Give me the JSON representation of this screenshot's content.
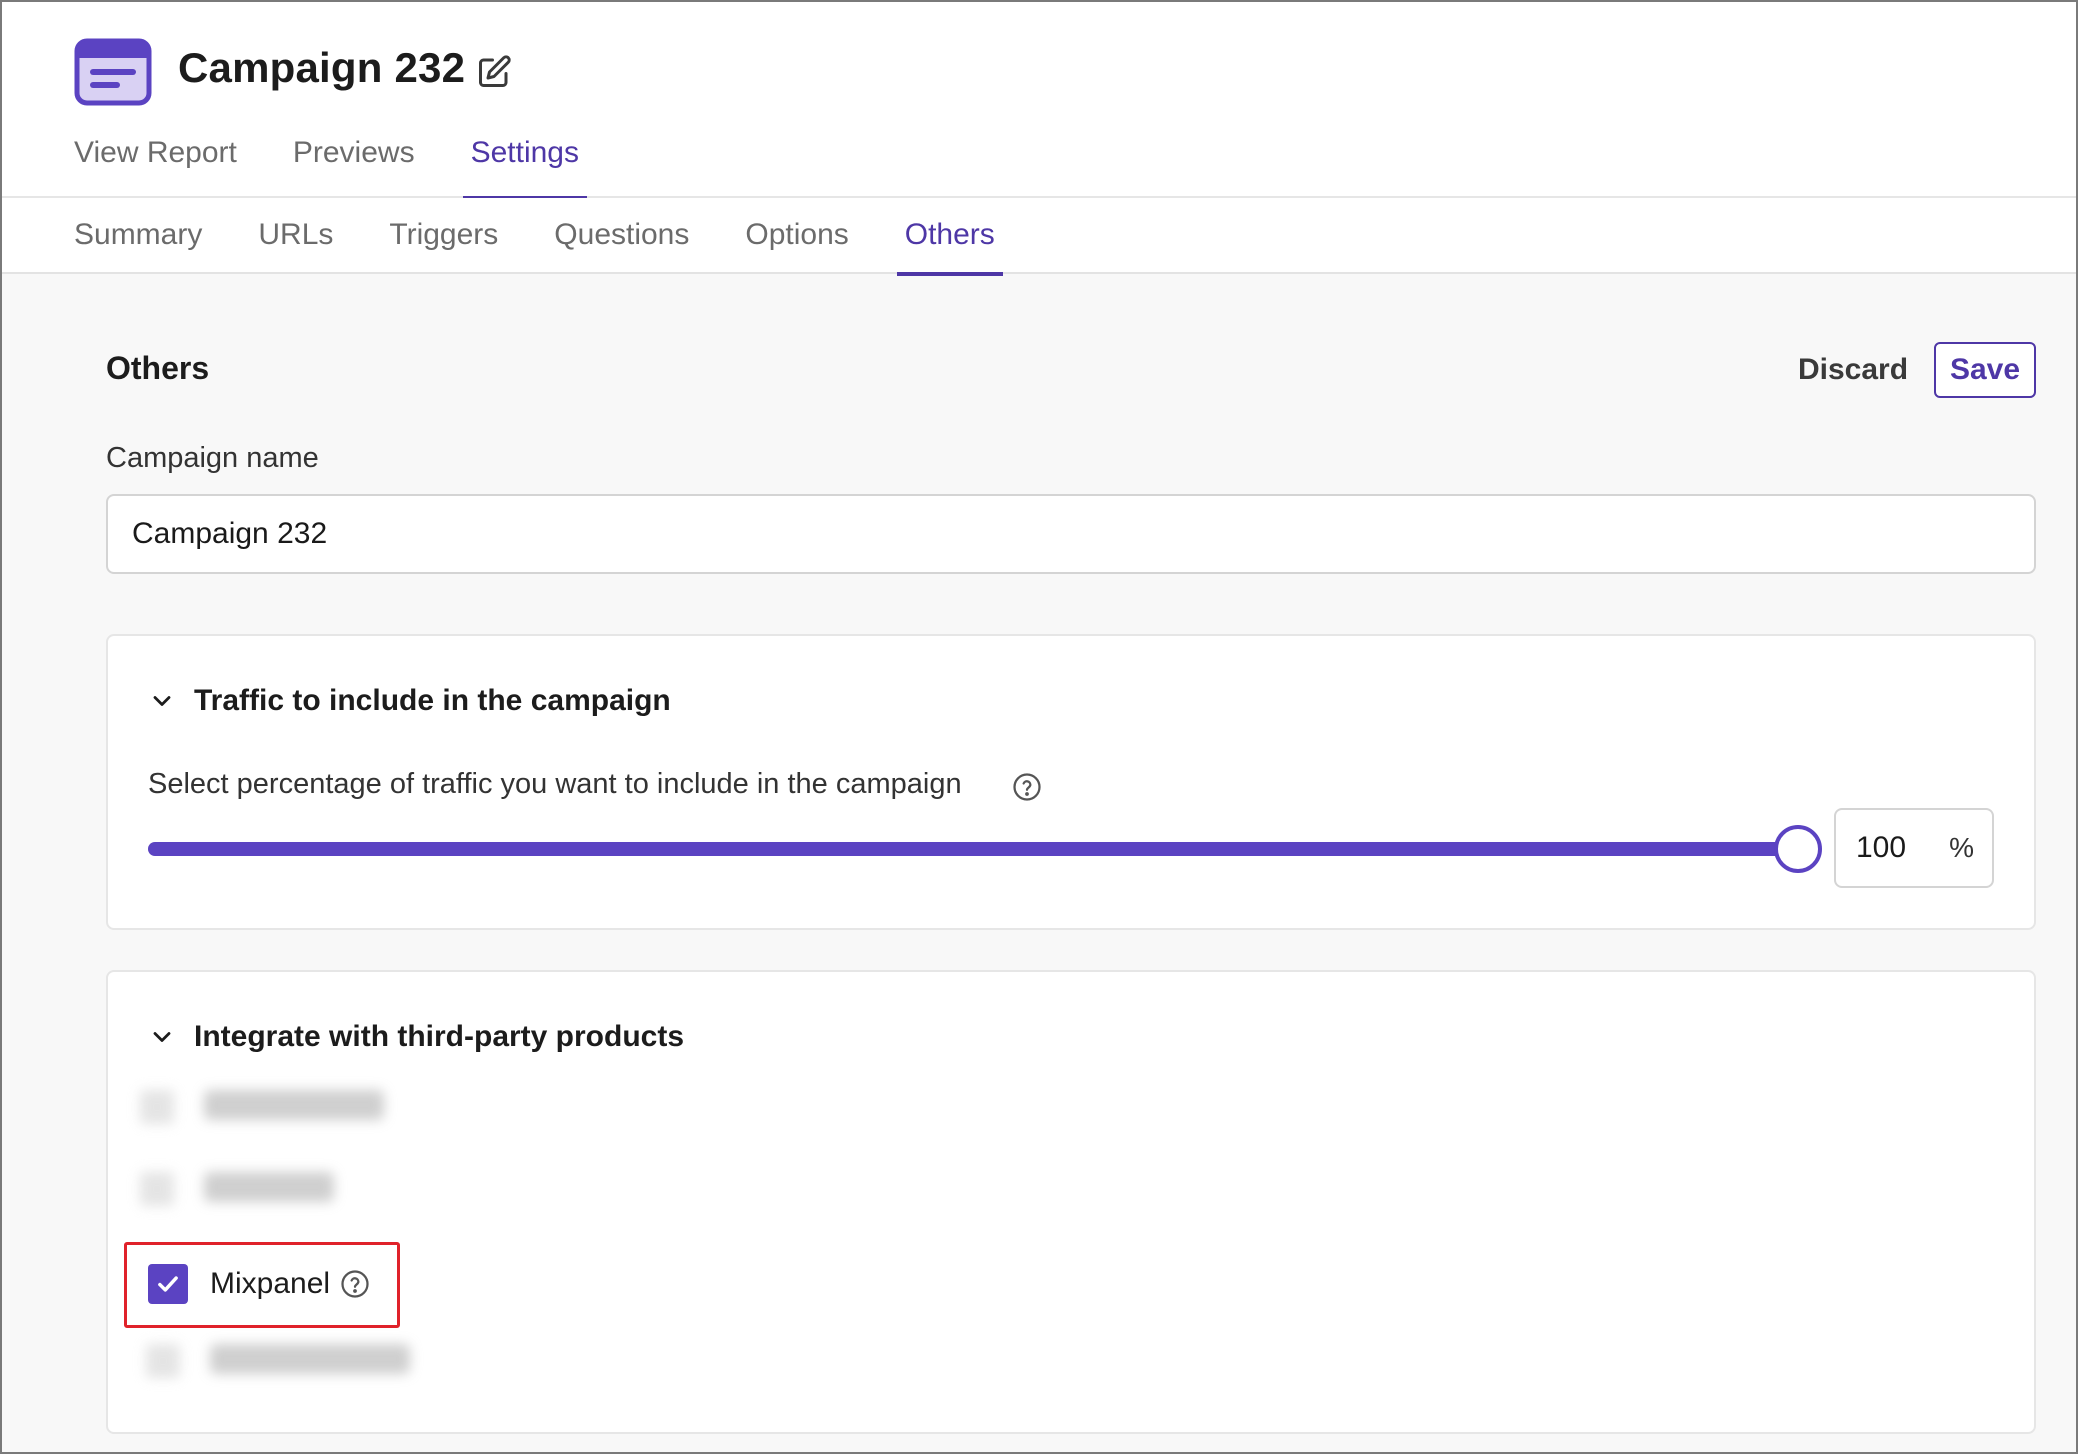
{
  "header": {
    "title": "Campaign 232",
    "tabs": [
      {
        "label": "View Report",
        "active": false
      },
      {
        "label": "Previews",
        "active": false
      },
      {
        "label": "Settings",
        "active": true
      }
    ]
  },
  "subtabs": [
    {
      "label": "Summary",
      "active": false
    },
    {
      "label": "URLs",
      "active": false
    },
    {
      "label": "Triggers",
      "active": false
    },
    {
      "label": "Questions",
      "active": false
    },
    {
      "label": "Options",
      "active": false
    },
    {
      "label": "Others",
      "active": true
    }
  ],
  "section": {
    "title": "Others",
    "discard_label": "Discard",
    "save_label": "Save"
  },
  "campaign_name": {
    "label": "Campaign name",
    "value": "Campaign 232"
  },
  "traffic": {
    "title": "Traffic to include in the campaign",
    "description": "Select percentage of traffic you want to include in the campaign",
    "percent": 100,
    "percent_value": "100",
    "unit": "%"
  },
  "integrations": {
    "title": "Integrate with third-party products",
    "items": [
      {
        "label": "Mixpanel",
        "checked": true
      }
    ]
  },
  "colors": {
    "accent": "#4e37a6",
    "slider": "#5b43c2",
    "highlight": "#e0222a"
  },
  "icons": {
    "app": "campaign-card-icon",
    "edit": "edit-pencil-icon",
    "chevron": "chevron-down-icon",
    "help": "question-circle-icon",
    "check": "checkmark-icon"
  }
}
